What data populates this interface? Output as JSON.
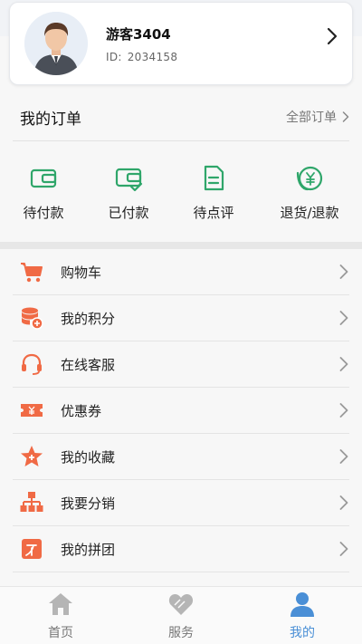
{
  "profile": {
    "name": "游客3404",
    "id_label": "ID:",
    "id_value": "2034158"
  },
  "orders": {
    "title": "我的订单",
    "all_label": "全部订单",
    "items": [
      {
        "label": "待付款",
        "icon": "wallet-icon"
      },
      {
        "label": "已付款",
        "icon": "wallet-check-icon"
      },
      {
        "label": "待点评",
        "icon": "document-icon"
      },
      {
        "label": "退货/退款",
        "icon": "refund-yen-icon"
      }
    ]
  },
  "menu": [
    {
      "label": "购物车",
      "icon": "shopping-cart-icon"
    },
    {
      "label": "我的积分",
      "icon": "points-coins-icon"
    },
    {
      "label": "在线客服",
      "icon": "headset-icon"
    },
    {
      "label": "优惠券",
      "icon": "coupon-icon"
    },
    {
      "label": "我的收藏",
      "icon": "star-icon"
    },
    {
      "label": "我要分销",
      "icon": "org-chart-icon"
    },
    {
      "label": "我的拼团",
      "icon": "group-buy-icon"
    }
  ],
  "tabbar": [
    {
      "label": "首页",
      "icon": "home-icon"
    },
    {
      "label": "服务",
      "icon": "heart-icon"
    },
    {
      "label": "我的",
      "icon": "user-icon",
      "active": true
    }
  ],
  "colors": {
    "order_icon_green": "#2fa66a",
    "menu_icon_orange": "#f06a45",
    "tab_active_blue": "#4a8fd6",
    "tab_inactive_gray": "#b5b5b5"
  }
}
